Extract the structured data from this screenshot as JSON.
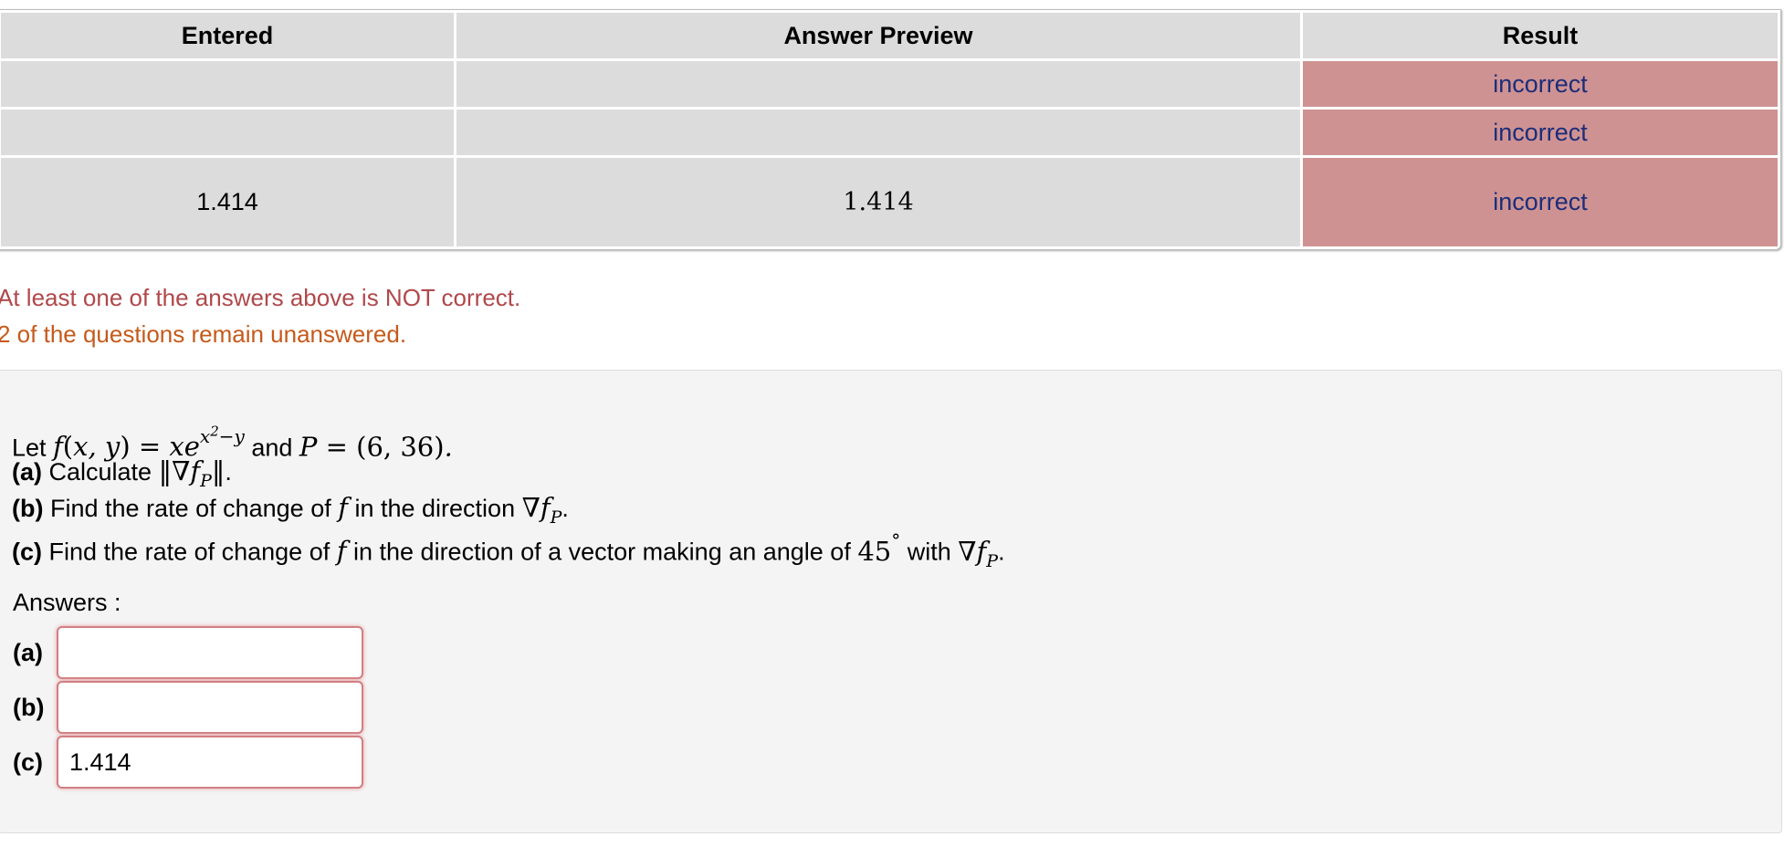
{
  "table": {
    "headers": [
      "Entered",
      "Answer Preview",
      "Result"
    ],
    "rows": [
      {
        "entered": "",
        "preview": "",
        "result": "incorrect"
      },
      {
        "entered": "",
        "preview": "",
        "result": "incorrect"
      },
      {
        "entered": "1.414",
        "preview": "1.414",
        "result": "incorrect"
      }
    ]
  },
  "messages": {
    "incorrect": "At least one of the answers above is NOT correct.",
    "unanswered": "2 of the questions remain unanswered."
  },
  "problem": {
    "intro_let": "Let",
    "intro_and": "and",
    "part_a_label": "(a)",
    "part_a_text": "Calculate",
    "part_b_label": "(b)",
    "part_b_text": "Find the rate of change of",
    "part_b_text2": "in the direction",
    "part_c_label": "(c)",
    "part_c_text": "Find the rate of change of",
    "part_c_text2": "in the direction of a vector making an angle of",
    "part_c_angle": "45",
    "part_c_text3": "with",
    "point": "(6, 36)"
  },
  "answers": {
    "label": "Answers :",
    "items": [
      {
        "label": "(a)",
        "value": ""
      },
      {
        "label": "(b)",
        "value": ""
      },
      {
        "label": "(c)",
        "value": "1.414"
      }
    ]
  },
  "colors": {
    "result_bg": "#cf9292",
    "result_text": "#1b2d7a",
    "incorrect_msg": "#b0484b",
    "unanswered_msg": "#c55a1b"
  }
}
